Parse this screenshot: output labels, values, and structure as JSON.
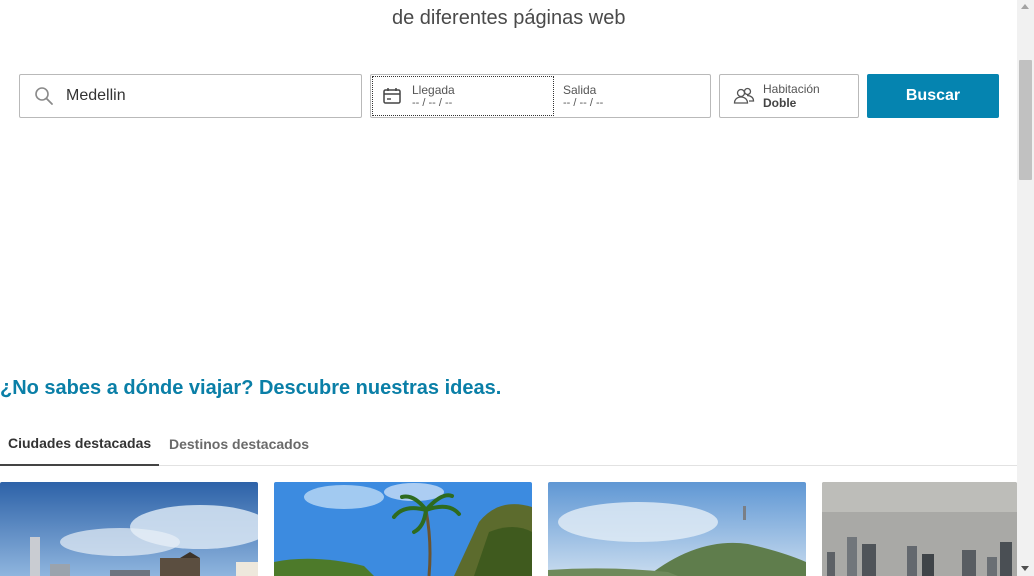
{
  "hero": {
    "subtitle": "de diferentes páginas web"
  },
  "search": {
    "destination_value": "Medellin",
    "destination_icon": "search-icon",
    "checkin_label": "Llegada",
    "checkin_placeholder": "-- / -- / --",
    "checkout_label": "Salida",
    "checkout_placeholder": "-- / -- / --",
    "calendar_icon": "calendar-icon",
    "room_label": "Habitación",
    "room_value": "Doble",
    "room_icon": "users-icon",
    "button_label": "Buscar"
  },
  "ideas": {
    "title": "¿No sabes a dónde viajar? Descubre nuestras ideas.",
    "tabs": [
      {
        "label": "Ciudades destacadas",
        "active": true
      },
      {
        "label": "Destinos destacados",
        "active": false
      }
    ]
  },
  "colors": {
    "accent": "#0584b0",
    "title": "#0a7fa7"
  }
}
